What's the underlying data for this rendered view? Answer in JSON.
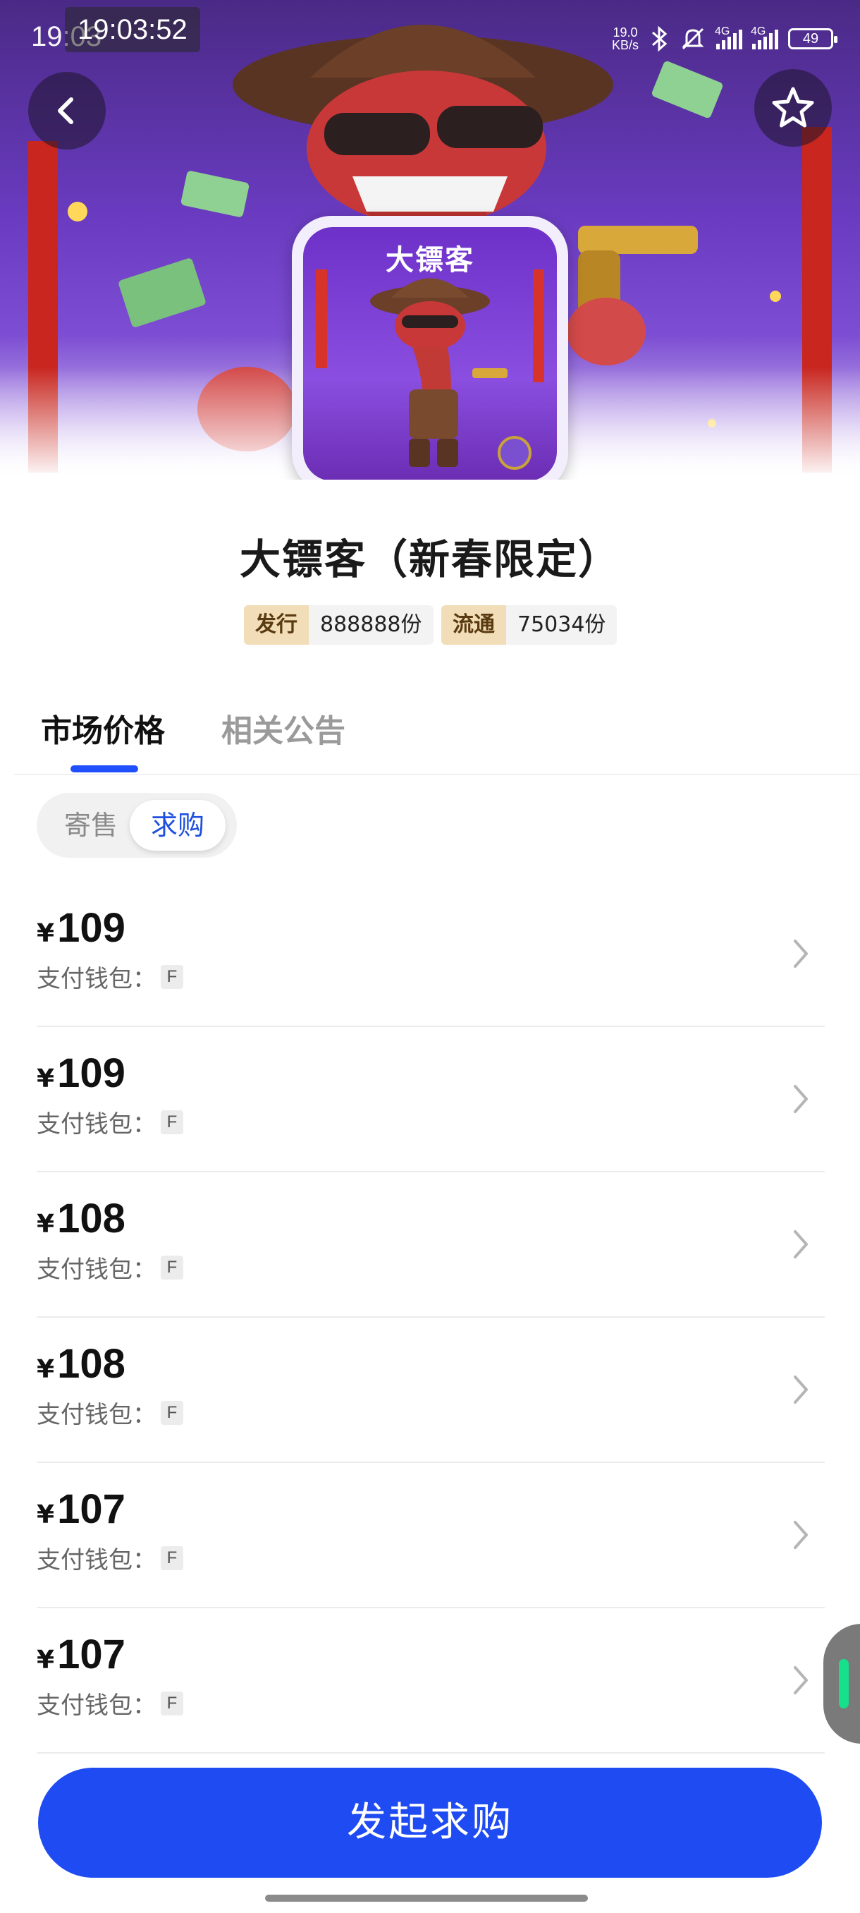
{
  "status_bar": {
    "time_under": "19:03",
    "time_overlay": "19:03:52",
    "net_speed_value": "19.0",
    "net_speed_unit": "KB/s",
    "signal1_label": "4G",
    "signal2_label": "4G",
    "battery": "49"
  },
  "header": {
    "back_icon": "chevron-left-icon",
    "favorite_icon": "star-outline-icon"
  },
  "product": {
    "thumbnail_brand": "大镖客",
    "title": "大镖客（新春限定）",
    "issue_label": "发行",
    "issue_value": "888888份",
    "circulation_label": "流通",
    "circulation_value": "75034份"
  },
  "tabs": [
    {
      "label": "市场价格",
      "active": true
    },
    {
      "label": "相关公告",
      "active": false
    }
  ],
  "segment": {
    "consign_label": "寄售",
    "buy_label": "求购",
    "selected": "求购"
  },
  "orders": [
    {
      "currency": "¥",
      "price": "109",
      "wallet_label": "支付钱包：",
      "wallet_tag": "F"
    },
    {
      "currency": "¥",
      "price": "109",
      "wallet_label": "支付钱包：",
      "wallet_tag": "F"
    },
    {
      "currency": "¥",
      "price": "108",
      "wallet_label": "支付钱包：",
      "wallet_tag": "F"
    },
    {
      "currency": "¥",
      "price": "108",
      "wallet_label": "支付钱包：",
      "wallet_tag": "F"
    },
    {
      "currency": "¥",
      "price": "107",
      "wallet_label": "支付钱包：",
      "wallet_tag": "F"
    },
    {
      "currency": "¥",
      "price": "107",
      "wallet_label": "支付钱包：",
      "wallet_tag": "F"
    }
  ],
  "cta": {
    "label": "发起求购"
  },
  "colors": {
    "accent": "#1f4bf2",
    "tab_underline": "#1f4fff",
    "stat_label_bg": "#f1ddb8",
    "hero_purple": "#6a3bc0"
  }
}
